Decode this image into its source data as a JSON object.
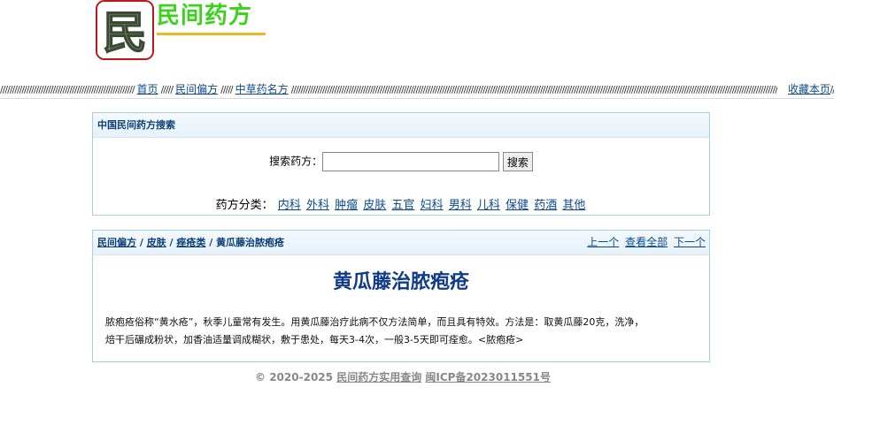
{
  "header": {
    "logo_char": "民",
    "site_title": "民间药方"
  },
  "nav": {
    "items": [
      "首页",
      "民间偏方",
      "中草药名方"
    ],
    "separator": "/////",
    "bookmark": "收藏本页"
  },
  "search": {
    "heading": "中国民间药方搜索",
    "label": "搜索药方：",
    "input_value": "",
    "button": "搜索",
    "category_label": "药方分类：",
    "categories": [
      "内科",
      "外科",
      "肿瘤",
      "皮肤",
      "五官",
      "妇科",
      "男科",
      "儿科",
      "保健",
      "药酒",
      "其他"
    ]
  },
  "article": {
    "breadcrumb": [
      "民间偏方",
      "皮肤",
      "痤疮类"
    ],
    "breadcrumb_sep": " / ",
    "breadcrumb_current": "黄瓜藤治脓疱疮",
    "pager": {
      "prev": "上一个",
      "all": "查看全部",
      "next": "下一个"
    },
    "title": "黄瓜藤治脓疱疮",
    "body_line1": "脓疱疮俗称“黄水疮”，秋季儿童常有发生。用黄瓜藤治疗此病不仅方法简单，而且具有特效。方法是：取黄瓜藤20克，洗净，",
    "body_line2": "焙干后碾成粉状，加香油适量调成糊状，敷于患处，每天3-4次，一般3-5天即可痊愈。<脓疱疮>"
  },
  "footer": {
    "copyright": "© 2020-2025",
    "site_link": "民间药方实用查询",
    "icp": "闽ICP备2023011551号"
  },
  "colors": {
    "title_green": "#3bd21c",
    "underline_orange": "#f0b624",
    "logo_border": "#c0151a",
    "link_blue": "#0b4a8e",
    "heading_blue": "#113a8a",
    "box_border": "#a9cfe6"
  }
}
